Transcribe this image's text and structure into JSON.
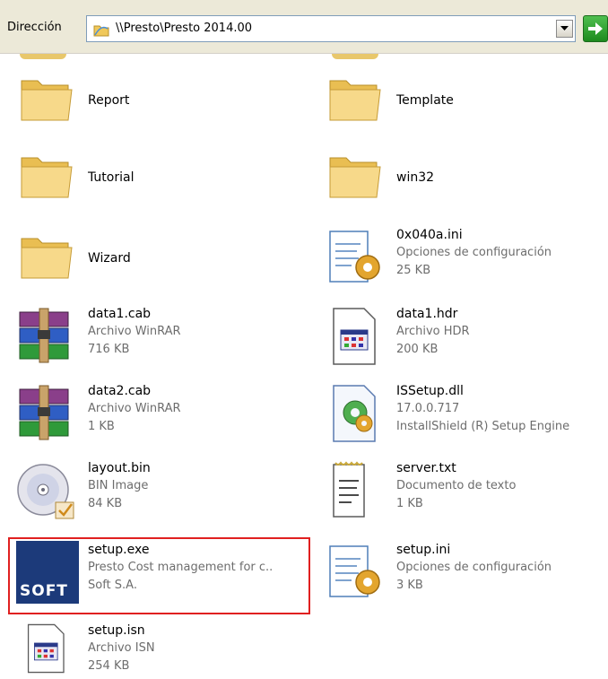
{
  "address": {
    "label": "Dirección",
    "path": "\\\\Presto\\Presto 2014.00"
  },
  "items": [
    {
      "name": "Report",
      "icon": "folder-icon"
    },
    {
      "name": "Template",
      "icon": "folder-icon"
    },
    {
      "name": "Tutorial",
      "icon": "folder-icon"
    },
    {
      "name": "win32",
      "icon": "folder-icon"
    },
    {
      "name": "Wizard",
      "icon": "folder-icon"
    },
    {
      "name": "0x040a.ini",
      "type": "Opciones de configuración",
      "size": "25 KB",
      "icon": "config-file-icon"
    },
    {
      "name": "data1.cab",
      "type": "Archivo WinRAR",
      "size": "716 KB",
      "icon": "winrar-archive-icon"
    },
    {
      "name": "data1.hdr",
      "type": "Archivo HDR",
      "size": "200 KB",
      "icon": "generic-file-icon"
    },
    {
      "name": "data2.cab",
      "type": "Archivo WinRAR",
      "size": "1 KB",
      "icon": "winrar-archive-icon"
    },
    {
      "name": "ISSetup.dll",
      "type": "17.0.0.717",
      "size": "InstallShield (R) Setup Engine",
      "icon": "dll-file-icon"
    },
    {
      "name": "layout.bin",
      "type": "BIN Image",
      "size": "84 KB",
      "icon": "disc-image-icon"
    },
    {
      "name": "server.txt",
      "type": "Documento de texto",
      "size": "1 KB",
      "icon": "text-file-icon"
    },
    {
      "name": "setup.exe",
      "type": "Presto Cost management for c..",
      "size": "Soft S.A.",
      "icon": "soft-app-icon",
      "logo_text": "SOFT"
    },
    {
      "name": "setup.ini",
      "type": "Opciones de configuración",
      "size": "3 KB",
      "icon": "config-file-icon"
    },
    {
      "name": "setup.isn",
      "type": "Archivo ISN",
      "size": "254 KB",
      "icon": "generic-file-icon"
    }
  ],
  "colors": {
    "selection_border": "#e02020",
    "folder": "#f5d27a",
    "secondary_text": "#6d6d6d"
  }
}
